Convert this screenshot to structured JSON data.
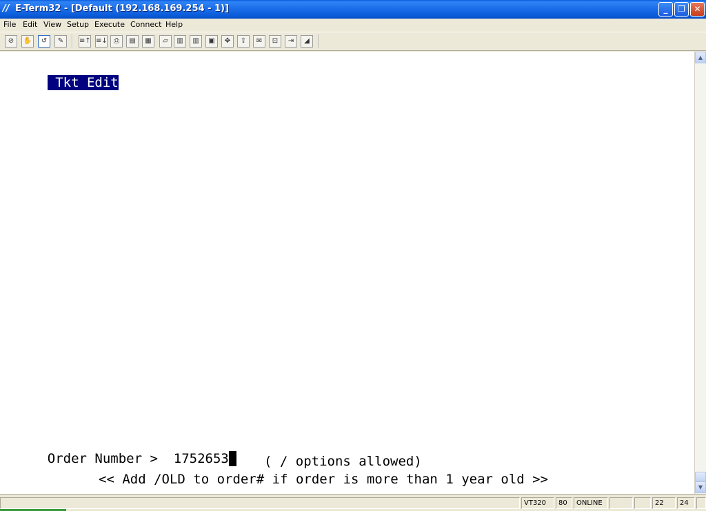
{
  "window": {
    "title": "E-Term32 - [Default (192.168.169.254 - 1)]",
    "app_icon_glyph": "//",
    "controls": {
      "minimize": "_",
      "maximize": "❐",
      "close": "✕"
    }
  },
  "menu": {
    "items": [
      "File",
      "Edit",
      "View",
      "Setup",
      "Execute",
      "Connect",
      "Help"
    ]
  },
  "toolbar": {
    "buttons": [
      "⊘",
      "✋",
      "↺",
      "✎",
      "≡↑",
      "≡↓",
      "⎙",
      "▤",
      "▦",
      "▱",
      "▥",
      "▥",
      "▣",
      "✥",
      "⇪",
      "✉",
      "⊡",
      "⇥",
      "◢"
    ]
  },
  "terminal": {
    "header": " Tkt Edit",
    "prompt_label": "Order Number >  ",
    "prompt_value": "1752653",
    "hint1": "( / options allowed)",
    "hint2": "<< Add /OLD to order# if order is more than 1 year old >>"
  },
  "scrollbar": {
    "up": "▲",
    "down": "▼"
  },
  "status": {
    "emulation": "VT320",
    "columns": "80",
    "connection": "ONLINE",
    "row": "22",
    "col": "24"
  }
}
